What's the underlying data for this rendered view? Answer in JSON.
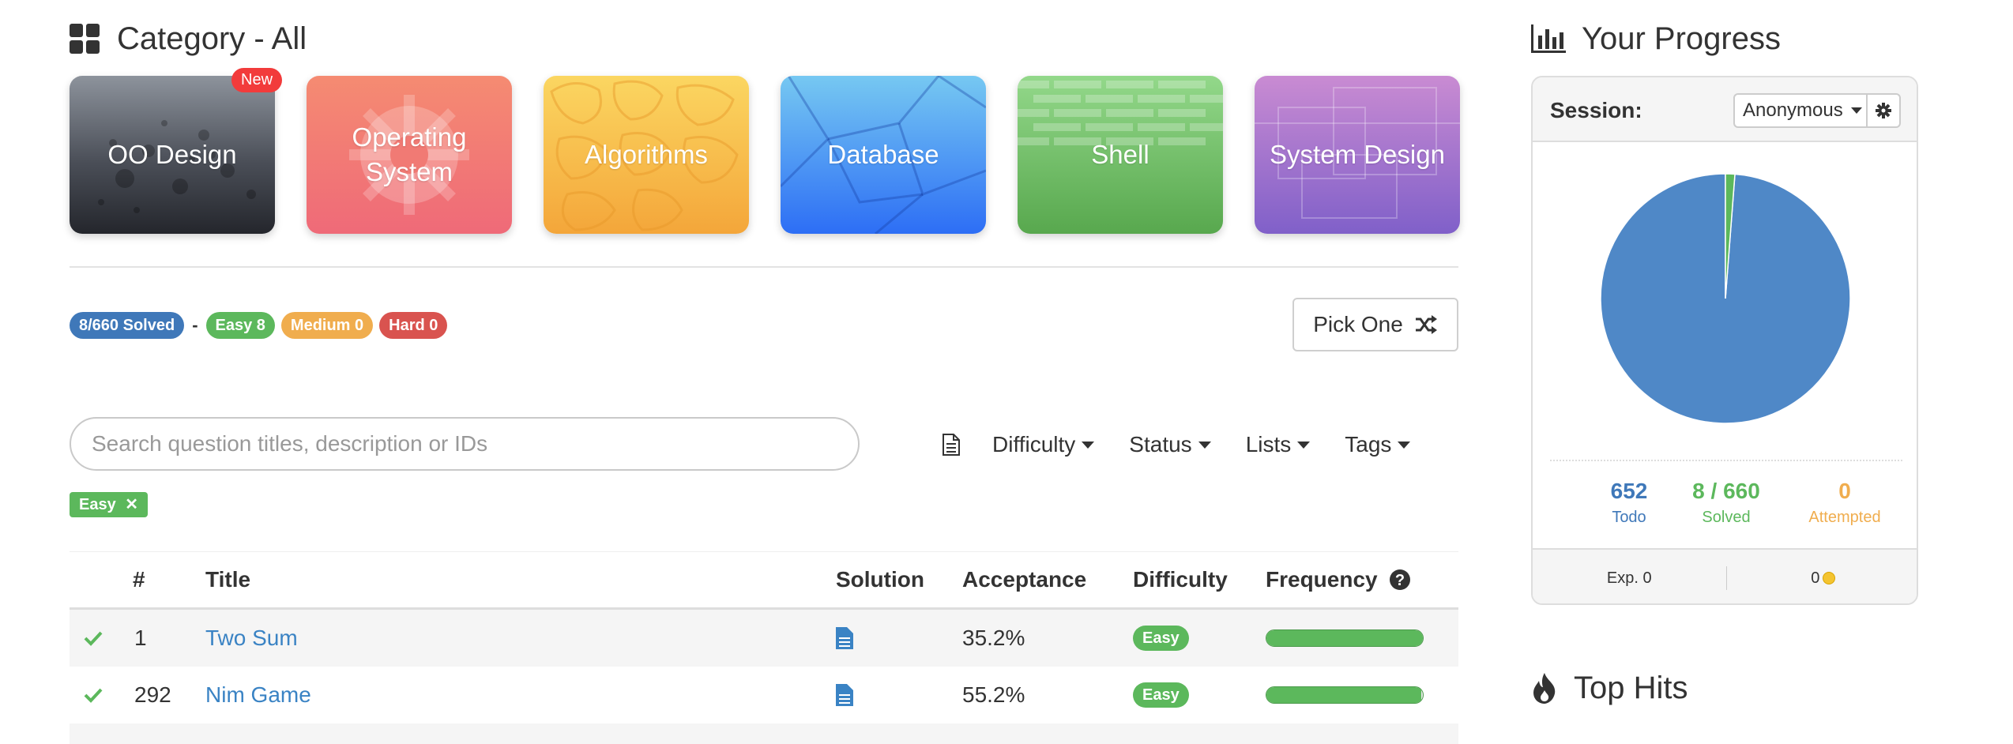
{
  "category": {
    "title": "Category - All",
    "icon": "grid-icon"
  },
  "cards": [
    {
      "label": "OO Design",
      "badge": "New"
    },
    {
      "label": "Operating System"
    },
    {
      "label": "Algorithms"
    },
    {
      "label": "Database"
    },
    {
      "label": "Shell"
    },
    {
      "label": "System Design"
    }
  ],
  "stats": {
    "solved": "8/660 Solved",
    "separator": "-",
    "easy": "Easy 8",
    "medium": "Medium 0",
    "hard": "Hard 0"
  },
  "pick_one": {
    "label": "Pick One",
    "icon": "shuffle-icon"
  },
  "search": {
    "placeholder": "Search question titles, description or IDs"
  },
  "filters": {
    "icon": "document-icon",
    "difficulty": "Difficulty",
    "status": "Status",
    "lists": "Lists",
    "tags": "Tags"
  },
  "active_filter": {
    "label": "Easy",
    "remove_icon": "close-icon"
  },
  "table": {
    "headers": {
      "num": "#",
      "title": "Title",
      "solution": "Solution",
      "acceptance": "Acceptance",
      "difficulty": "Difficulty",
      "frequency": "Frequency"
    },
    "rows": [
      {
        "status": "check-icon",
        "num": "1",
        "title": "Two Sum",
        "solution": "document-icon",
        "acceptance": "35.2%",
        "difficulty": "Easy",
        "frequency": 1.0
      },
      {
        "status": "check-icon",
        "num": "292",
        "title": "Nim Game",
        "solution": "document-icon",
        "acceptance": "55.2%",
        "difficulty": "Easy",
        "frequency": 0.99
      }
    ]
  },
  "progress": {
    "title": "Your Progress",
    "icon": "bar-chart-icon",
    "session_label": "Session:",
    "session_value": "Anonymous",
    "todo": {
      "value": "652",
      "label": "Todo"
    },
    "solved": {
      "value": "8 / 660",
      "label": "Solved"
    },
    "attempted": {
      "value": "0",
      "label": "Attempted"
    },
    "exp": "Exp. 0",
    "coins": "0",
    "pie": {
      "todo": 652,
      "solved": 8,
      "attempted": 0
    },
    "colors": {
      "todo": "#4f88c7",
      "solved": "#5cb85c",
      "attempted": "#f0ad4e"
    }
  },
  "top_hits": {
    "title": "Top Hits",
    "icon": "fire-icon"
  }
}
